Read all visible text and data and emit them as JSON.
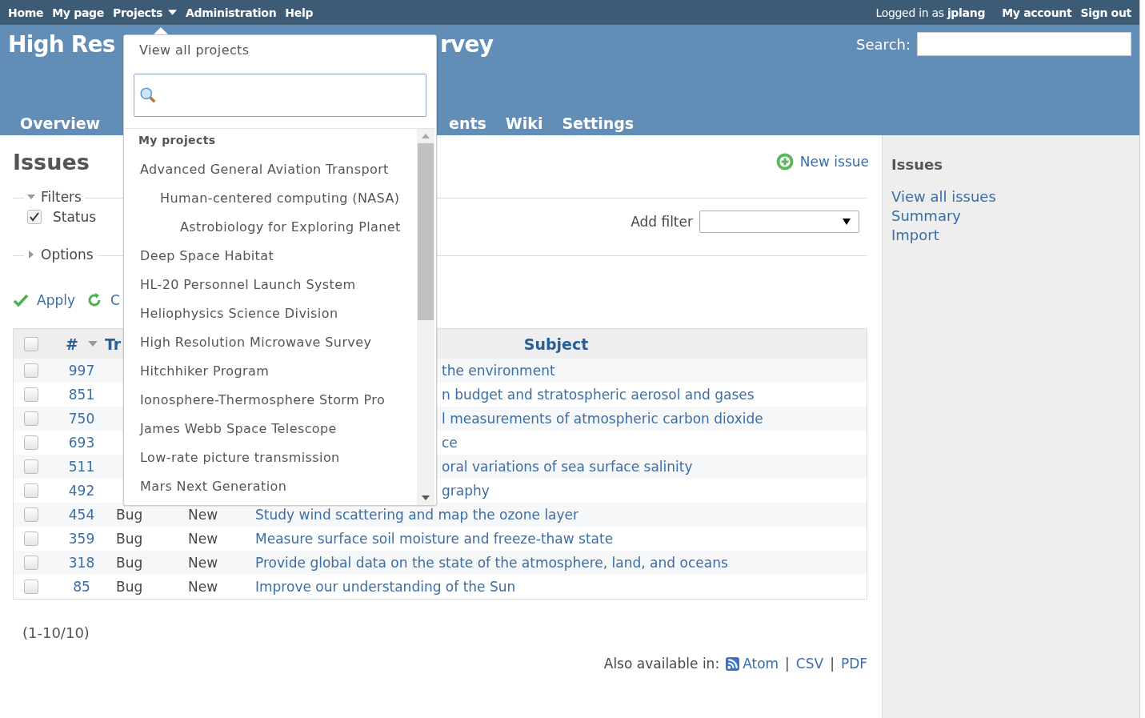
{
  "top_menu": [
    {
      "label": "Home",
      "kind": "link"
    },
    {
      "label": "My page",
      "kind": "link"
    },
    {
      "label": "Projects",
      "kind": "menu"
    },
    {
      "label": "Administration",
      "kind": "link"
    },
    {
      "label": "Help",
      "kind": "link"
    }
  ],
  "account": {
    "logged_in": "Logged in as **jplang**",
    "links": [
      "My account",
      "Sign out"
    ]
  },
  "header": {
    "title_left": "High Res",
    "title_right": "rvey",
    "search_label": "Search:",
    "tabs_left": [
      {
        "label": "Overview",
        "selected": false
      }
    ],
    "tabs_right": [
      {
        "label": "ents",
        "selected": false
      },
      {
        "label": "Wiki",
        "selected": false
      },
      {
        "label": "Settings",
        "selected": false
      }
    ]
  },
  "project_menu": {
    "open": true,
    "view_all": "View all projects",
    "heading": "My projects",
    "projects": [
      {
        "name": "Advanced General Aviation Transport",
        "children": [
          {
            "name": "Human-centered computing (NASA)",
            "children": [
              {
                "name": "Astrobiology for Exploring Planet"
              }
            ]
          }
        ]
      },
      {
        "name": "Deep Space Habitat"
      },
      {
        "name": "HL-20 Personnel Launch System"
      },
      {
        "name": "Heliophysics Science Division"
      },
      {
        "name": "High Resolution Microwave Survey"
      },
      {
        "name": "Hitchhiker Program"
      },
      {
        "name": "Ionosphere-Thermosphere Storm Pro"
      },
      {
        "name": "James Webb Space Telescope"
      },
      {
        "name": "Low-rate picture transmission"
      },
      {
        "name": "Mars Next Generation"
      }
    ]
  },
  "content": {
    "title": "Issues",
    "new_issue": "New issue",
    "filters": {
      "label": "Filters",
      "expanded": true,
      "status": {
        "label": "Status",
        "checked": true
      },
      "add_filter": "Add filter"
    },
    "options": {
      "label": "Options",
      "expanded": false
    },
    "apply": "Apply",
    "clear": "C",
    "table": {
      "select_all": {
        "checked": false
      },
      "columns": [
        "#",
        "Tr",
        "Subject"
      ],
      "rows": [
        {
          "id": "997",
          "subject": "the environment",
          "checked": false
        },
        {
          "id": "851",
          "subject": "n budget and stratospheric aerosol and gases",
          "checked": false
        },
        {
          "id": "750",
          "subject": "l measurements of atmospheric carbon dioxide",
          "checked": false
        },
        {
          "id": "693",
          "subject": "ce",
          "checked": false
        },
        {
          "id": "511",
          "subject": "oral variations of sea surface salinity",
          "checked": false
        },
        {
          "id": "492",
          "subject": "graphy",
          "checked": false
        },
        {
          "id": "454",
          "tracker": "Bug",
          "status": "New",
          "subject": "Study wind scattering and map the ozone layer",
          "checked": false
        },
        {
          "id": "359",
          "tracker": "Bug",
          "status": "New",
          "subject": "Measure surface soil moisture and freeze-thaw state",
          "checked": false
        },
        {
          "id": "318",
          "tracker": "Bug",
          "status": "New",
          "subject": "Provide global data on the state of the atmosphere, land, and oceans",
          "checked": false
        },
        {
          "id": "85",
          "tracker": "Bug",
          "status": "New",
          "subject": "Improve our understanding of the Sun",
          "checked": false
        }
      ]
    },
    "pagination": "(1-10/10)",
    "export": {
      "label": "Also available in:",
      "formats": [
        "Atom",
        "CSV",
        "PDF"
      ],
      "separators": [
        "|",
        "|"
      ]
    }
  },
  "sidebar": {
    "title": "Issues",
    "links": [
      "View all issues",
      "Summary",
      "Import"
    ]
  }
}
